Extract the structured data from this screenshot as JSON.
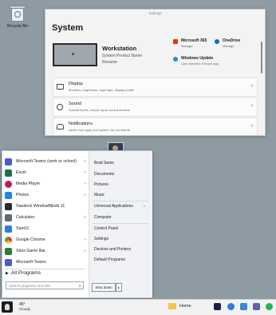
{
  "desktop": {
    "recycle_label": "Recycle Bin"
  },
  "settings": {
    "window_title": "Settings",
    "heading": "System",
    "device": {
      "name": "Workstation",
      "product": "System Product Name",
      "rename": "Rename"
    },
    "quick": [
      {
        "title": "Microsoft 365",
        "meta": "Manage"
      },
      {
        "title": "OneDrive",
        "meta": "Manage"
      },
      {
        "title": "Windows Update",
        "meta": "Last checked: 8 hours ago"
      }
    ],
    "rows": [
      {
        "title": "Display",
        "sub": "Monitors, brightness, night light, display profile"
      },
      {
        "title": "Sound",
        "sub": "Volume levels, output, input, sound devices"
      },
      {
        "title": "Notifications",
        "sub": "Alerts from apps and system, do not disturb"
      }
    ]
  },
  "start_menu": {
    "programs": [
      {
        "label": "Microsoft Teams (work or school)",
        "arrow": "›",
        "color": "#5059c9"
      },
      {
        "label": "Excel",
        "arrow": "›",
        "color": "#1f7244"
      },
      {
        "label": "Media Player",
        "arrow": "›",
        "color": "#c2185b"
      },
      {
        "label": "Photos",
        "arrow": "›",
        "color": "#1e88e5"
      },
      {
        "label": "Stardock WindowBlinds 11",
        "arrow": "",
        "color": "#2a2a2a"
      },
      {
        "label": "Calculator",
        "arrow": "›",
        "color": "#5f6b76"
      },
      {
        "label": "Start11",
        "arrow": "",
        "color": "#2d7be5"
      },
      {
        "label": "Google Chrome",
        "arrow": "›",
        "color": "#e53935"
      },
      {
        "label": "Xbox Game Bar",
        "arrow": "›",
        "color": "#2e7d32"
      },
      {
        "label": "Microsoft Teams",
        "arrow": "",
        "color": "#5059c9"
      }
    ],
    "all_programs": "All Programs",
    "search_placeholder": "Search programs and files",
    "right_links": [
      {
        "label": "Brad Sams",
        "arrow": ""
      },
      {
        "label": "Documents",
        "arrow": ""
      },
      {
        "label": "Pictures",
        "arrow": ""
      },
      {
        "label": "Music",
        "arrow": ""
      },
      {
        "label": "Universal Applications",
        "arrow": "›"
      },
      {
        "label": "Computer",
        "arrow": ""
      },
      {
        "label": "Control Panel",
        "arrow": ""
      },
      {
        "label": "Settings",
        "arrow": ""
      },
      {
        "label": "Devices and Printers",
        "arrow": ""
      },
      {
        "label": "Default Programs",
        "arrow": ""
      }
    ],
    "shutdown_label": "Shut down",
    "shutdown_arrow": "▸"
  },
  "taskbar": {
    "weather_temp": "45°",
    "weather_desc": "Cloudy",
    "home_label": "Home"
  }
}
